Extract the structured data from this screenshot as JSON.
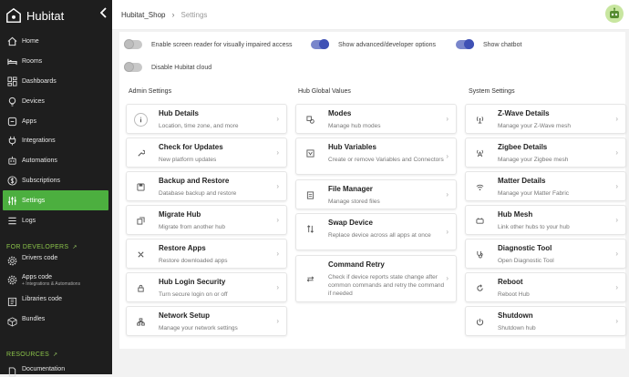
{
  "brand": {
    "name": "Hubitat"
  },
  "sidebar": {
    "nav": [
      {
        "label": "Home",
        "icon": "home-icon"
      },
      {
        "label": "Rooms",
        "icon": "bed-icon"
      },
      {
        "label": "Dashboards",
        "icon": "dashboard-icon"
      },
      {
        "label": "Devices",
        "icon": "bulb-icon"
      },
      {
        "label": "Apps",
        "icon": "apps-icon"
      },
      {
        "label": "Integrations",
        "icon": "plug-icon"
      },
      {
        "label": "Automations",
        "icon": "robot-icon"
      },
      {
        "label": "Subscriptions",
        "icon": "dollar-icon"
      },
      {
        "label": "Settings",
        "icon": "sliders-icon"
      },
      {
        "label": "Logs",
        "icon": "list-icon"
      }
    ],
    "developers_heading": "FOR DEVELOPERS",
    "dev_items": [
      {
        "label": "Drivers code",
        "sub": ""
      },
      {
        "label": "Apps code",
        "sub": "+ Integrations & Automations"
      },
      {
        "label": "Libraries code",
        "sub": ""
      },
      {
        "label": "Bundles",
        "sub": ""
      }
    ],
    "resources_heading": "RESOURCES",
    "resources_items": [
      {
        "label": "Documentation"
      }
    ]
  },
  "breadcrumb": {
    "hub": "Hubitat_Shop",
    "current": "Settings"
  },
  "toggles": [
    {
      "label": "Enable screen reader for visually impaired access",
      "state": "off"
    },
    {
      "label": "Show advanced/developer options",
      "state": "on"
    },
    {
      "label": "Show chatbot",
      "state": "on"
    },
    {
      "label": "Disable Hubitat cloud",
      "state": "off"
    }
  ],
  "columns": {
    "admin": {
      "title": "Admin Settings",
      "cards": [
        {
          "title": "Hub Details",
          "desc": "Location, time zone, and more"
        },
        {
          "title": "Check for Updates",
          "desc": "New platform updates"
        },
        {
          "title": "Backup and Restore",
          "desc": "Database backup and restore"
        },
        {
          "title": "Migrate Hub",
          "desc": "Migrate from another hub"
        },
        {
          "title": "Restore Apps",
          "desc": "Restore downloaded apps"
        },
        {
          "title": "Hub Login Security",
          "desc": "Turn secure login on or off"
        },
        {
          "title": "Network Setup",
          "desc": "Manage your network settings"
        }
      ]
    },
    "global": {
      "title": "Hub Global Values",
      "cards": [
        {
          "title": "Modes",
          "desc": "Manage hub modes"
        },
        {
          "title": "Hub Variables",
          "desc": "Create or remove Variables and Connectors"
        },
        {
          "title": "File Manager",
          "desc": "Manage stored files"
        },
        {
          "title": "Swap Device",
          "desc": "Replace device across all apps at once"
        },
        {
          "title": "Command Retry",
          "desc": "Check if device reports state change after common commands and retry the command if needed"
        }
      ]
    },
    "system": {
      "title": "System Settings",
      "cards": [
        {
          "title": "Z-Wave Details",
          "desc": "Manage your Z-Wave mesh"
        },
        {
          "title": "Zigbee Details",
          "desc": "Manage your Zigbee mesh"
        },
        {
          "title": "Matter Details",
          "desc": "Manage your Matter Fabric"
        },
        {
          "title": "Hub Mesh",
          "desc": "Link other hubs to your hub"
        },
        {
          "title": "Diagnostic Tool",
          "desc": "Open Diagnostic Tool"
        },
        {
          "title": "Reboot",
          "desc": "Reboot Hub"
        },
        {
          "title": "Shutdown",
          "desc": "Shutdown hub"
        }
      ]
    }
  },
  "colors": {
    "accent": "#4caf3f",
    "toggle_on": "#3f51b5",
    "sidebar": "#1e1e1e"
  }
}
